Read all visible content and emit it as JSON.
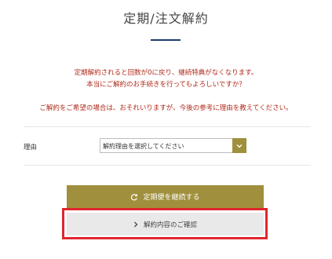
{
  "page": {
    "title": "定期/注文解約"
  },
  "warning": {
    "line1": "定期解約されると回数が0に戻り、継続特典がなくなります。",
    "line2": "本当にご解約のお手続きを行ってもよろしいですか？",
    "line3": "ご解約をご希望の場合は、おそれいりますが、今後の参考に理由を教えてください。"
  },
  "form": {
    "reason_label": "理由",
    "reason_select_value": "解約理由を選択してください"
  },
  "actions": {
    "continue_label": "定期便を継続する",
    "confirm_label": "解約内容のご確認"
  },
  "colors": {
    "accent": "#a08f3c",
    "warning_text": "#b02a1b",
    "highlight": "#e0262e",
    "title_underline": "#1f3a6e"
  },
  "icons": {
    "continue": "refresh-icon",
    "confirm": "chevron-right-icon",
    "select": "chevron-down-icon"
  }
}
